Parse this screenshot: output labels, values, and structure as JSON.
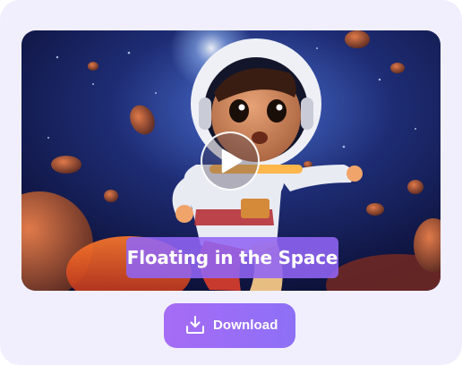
{
  "video": {
    "caption": "Floating in the Space",
    "play_icon": "play-icon"
  },
  "download": {
    "label": "Download",
    "icon": "download-icon"
  },
  "colors": {
    "card_background": "#f1effe",
    "accent": "#9a6df6",
    "caption_background": "#9164f5"
  }
}
